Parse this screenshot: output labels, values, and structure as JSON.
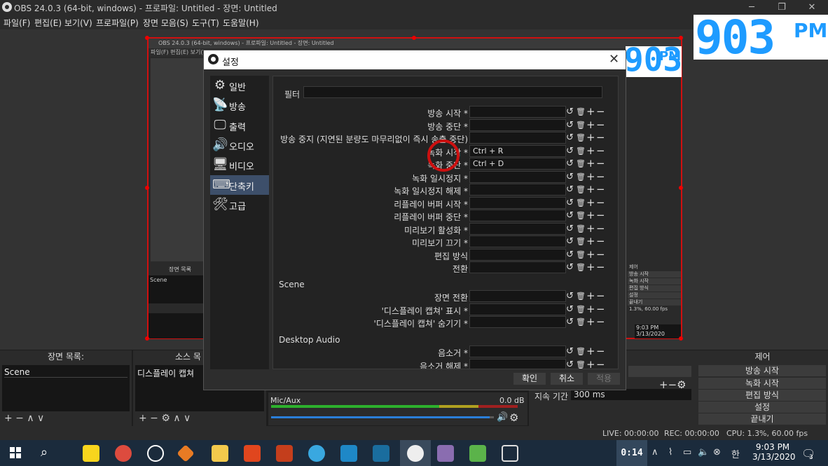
{
  "window": {
    "title": "OBS 24.0.3 (64-bit, windows) - 프로파일: Untitled - 장면: Untitled",
    "minimize": "─",
    "maximize": "❐",
    "close": "✕"
  },
  "menu": [
    "파일(F)",
    "편집(E)",
    "보기(V)",
    "프로파일(P)",
    "장면 모음(S)",
    "도구(T)",
    "도움말(H)"
  ],
  "nested_preview": {
    "title": "OBS 24.0.3 (64-bit, windows) - 프로파일: Untitled - 장면: Untitled",
    "menu": "파일(F)   편집(E)   보기(V)",
    "scene_dock_title": "장면 목록",
    "scene_item": "Scene",
    "right_dock_title": "제어",
    "right_items": [
      "방송 시작",
      "녹화 시작",
      "편집 방식",
      "설정",
      "끝내기"
    ],
    "status": "1.3%, 60.00 fps",
    "clock": "9:03 PM",
    "date": "3/13/2020"
  },
  "overlay_clock": {
    "digits": "903",
    "ampm": "PM"
  },
  "settings_dialog": {
    "title": "설정",
    "close": "✕",
    "sidebar": [
      {
        "icon": "⚙",
        "label": "일반"
      },
      {
        "icon": "📡",
        "label": "방송"
      },
      {
        "icon": "🖵",
        "label": "출력"
      },
      {
        "icon": "🔊",
        "label": "오디오"
      },
      {
        "icon": "🖥",
        "label": "비디오"
      },
      {
        "icon": "⌨",
        "label": "단축키"
      },
      {
        "icon": "🛠",
        "label": "고급"
      }
    ],
    "active_item": "단축키",
    "filter_label": "필터",
    "filter_value": "",
    "hotkeys_general": [
      {
        "label": "방송 시작 *",
        "value": ""
      },
      {
        "label": "방송 중단 *",
        "value": ""
      },
      {
        "label": "방송 중지 (지연된 분량도 마무리없이 즉시 송출 중단)",
        "value": ""
      },
      {
        "label": "녹화 시작 *",
        "value": "Ctrl + R"
      },
      {
        "label": "녹화 중단 *",
        "value": "Ctrl + D"
      },
      {
        "label": "녹화 일시정지 *",
        "value": ""
      },
      {
        "label": "녹화 일시정지 해제 *",
        "value": ""
      },
      {
        "label": "리플레이 버퍼 시작 *",
        "value": ""
      },
      {
        "label": "리플레이 버퍼 중단 *",
        "value": ""
      },
      {
        "label": "미리보기 활성화 *",
        "value": ""
      },
      {
        "label": "미리보기 끄기 *",
        "value": ""
      },
      {
        "label": "편집 방식",
        "value": ""
      },
      {
        "label": "전환",
        "value": ""
      }
    ],
    "section_scene": "Scene",
    "hotkeys_scene": [
      {
        "label": "장면 전환",
        "value": ""
      },
      {
        "label": "'디스플레이 캡쳐' 표시 *",
        "value": ""
      },
      {
        "label": "'디스플레이 캡쳐' 숨기기 *",
        "value": ""
      }
    ],
    "section_audio": "Desktop Audio",
    "hotkeys_audio": [
      {
        "label": "음소거 *",
        "value": ""
      },
      {
        "label": "음소거 해제 *",
        "value": ""
      }
    ],
    "row_buttons": {
      "revert": "↺",
      "delete": "🗑",
      "add": "+",
      "remove": "−"
    },
    "ok": "확인",
    "cancel": "취소",
    "apply": "적용"
  },
  "scenes_dock": {
    "title": "장면 목록:",
    "items": [
      "Scene"
    ],
    "footer": "+ −  ∧ ∨"
  },
  "sources_dock": {
    "title": "소스 목",
    "items": [
      "디스플레이 캡쳐"
    ],
    "footer": "+ − ⚙  ∧ ∨"
  },
  "mixer": {
    "label": "Mic/Aux",
    "level": "0.0 dB",
    "volume_fraction": 0.98
  },
  "transition": {
    "duration_label": "지속 기간",
    "duration_value": "300 ms"
  },
  "controls": {
    "title": "제어",
    "buttons": [
      "방송 시작",
      "녹화 시작",
      "편집 방식",
      "설정",
      "끝내기"
    ]
  },
  "status": {
    "live": "LIVE: 00:00:00",
    "rec": "REC: 00:00:00",
    "cpu": "CPU: 1.3%, 60.00 fps"
  },
  "taskbar": {
    "timer": "0:14",
    "ime": "한",
    "time": "9:03 PM",
    "date": "3/13/2020",
    "notifications": "3",
    "colors": {
      "bg": "#1b2b3c",
      "accent": "#1e9bff",
      "rec_red": "#cc1010"
    }
  }
}
